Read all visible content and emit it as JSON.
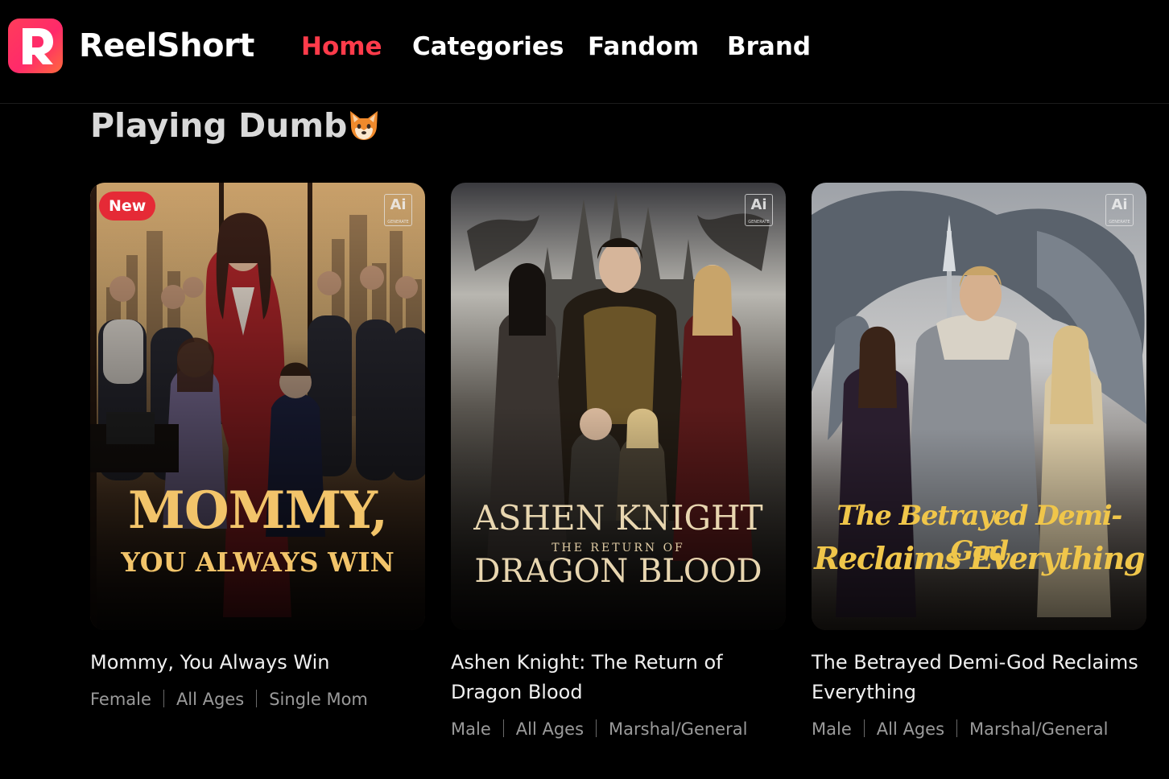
{
  "brand": {
    "name": "ReelShort",
    "logo_letter": "R"
  },
  "nav": [
    {
      "label": "Home",
      "active": true
    },
    {
      "label": "Categories",
      "active": false
    },
    {
      "label": "Fandom",
      "active": false
    },
    {
      "label": "Brand",
      "active": false
    }
  ],
  "section": {
    "title": "Playing Dumb",
    "emoji": "fox-face"
  },
  "cards": [
    {
      "title": "Mommy, You Always Win",
      "badge": "New",
      "ai_label": "Ai",
      "ai_sub": "GENERATE",
      "cover_line1": "MOMMY,",
      "cover_line2": "YOU ALWAYS WIN",
      "cover_line3": "",
      "tags": [
        "Female",
        "All Ages",
        "Single Mom"
      ]
    },
    {
      "title": "Ashen Knight: The Return of Dragon Blood",
      "badge": "",
      "ai_label": "Ai",
      "ai_sub": "GENERATE",
      "cover_line1": "ASHEN KNIGHT",
      "cover_line2": "THE RETURN OF",
      "cover_line3": "DRAGON BLOOD",
      "tags": [
        "Male",
        "All Ages",
        "Marshal/General"
      ]
    },
    {
      "title": "The Betrayed Demi-God Reclaims Everything",
      "badge": "",
      "ai_label": "Ai",
      "ai_sub": "GENERATE",
      "cover_line1": "The Betrayed Demi-God",
      "cover_line2": "Reclaims Everything",
      "cover_line3": "",
      "tags": [
        "Male",
        "All Ages",
        "Marshal/General"
      ]
    }
  ]
}
